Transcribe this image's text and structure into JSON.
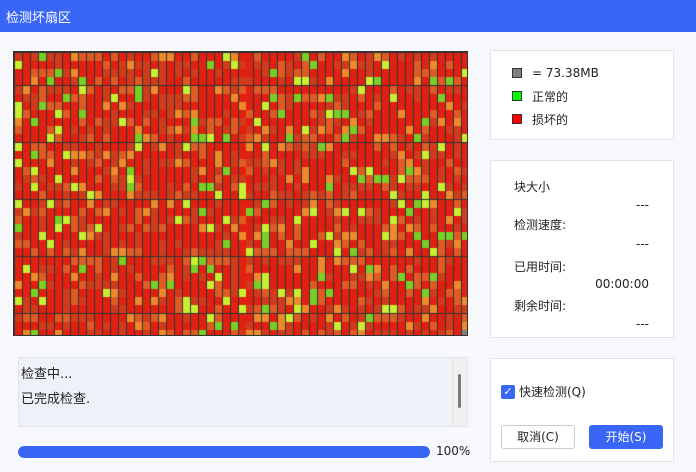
{
  "window": {
    "title": "检测坏扇区"
  },
  "legend": {
    "items": [
      {
        "label": "= 73.38MB",
        "color": "#808080"
      },
      {
        "label": "正常的",
        "color": "#00ff00"
      },
      {
        "label": "损坏的",
        "color": "#ff0000"
      }
    ]
  },
  "stats": {
    "block_size_label": "块大小",
    "block_size_value": "---",
    "speed_label": "检测速度:",
    "speed_value": "---",
    "elapsed_label": "已用时间:",
    "elapsed_value": "00:00:00",
    "remaining_label": "剩余时间:",
    "remaining_value": "---"
  },
  "log": {
    "lines": [
      "检查中...",
      "已完成检查."
    ]
  },
  "progress": {
    "percent": 100,
    "label": "100%"
  },
  "options": {
    "quick_check_label": "快速检测(Q)",
    "quick_check_checked": true
  },
  "buttons": {
    "cancel": "取消(C)",
    "start": "开始(S)"
  },
  "colors": {
    "accent": "#3a66f5",
    "grid_line": "#333333"
  }
}
